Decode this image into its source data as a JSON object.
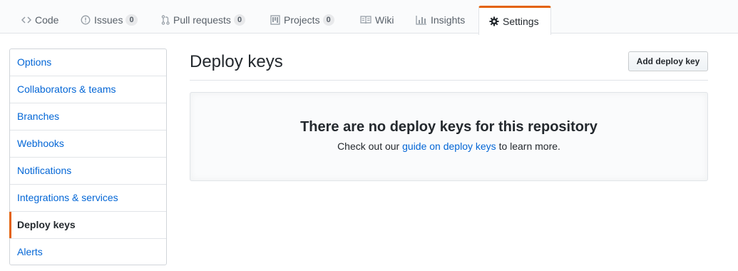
{
  "repo_nav": {
    "tabs": [
      {
        "label": "Code",
        "icon": "code-icon"
      },
      {
        "label": "Issues",
        "icon": "issue-icon",
        "count": "0"
      },
      {
        "label": "Pull requests",
        "icon": "pull-request-icon",
        "count": "0"
      },
      {
        "label": "Projects",
        "icon": "project-icon",
        "count": "0"
      },
      {
        "label": "Wiki",
        "icon": "book-icon"
      },
      {
        "label": "Insights",
        "icon": "graph-icon"
      },
      {
        "label": "Settings",
        "icon": "gear-icon",
        "selected": true
      }
    ],
    "accent_color": "#e36209"
  },
  "sidebar": {
    "items": [
      {
        "label": "Options"
      },
      {
        "label": "Collaborators & teams"
      },
      {
        "label": "Branches"
      },
      {
        "label": "Webhooks"
      },
      {
        "label": "Notifications"
      },
      {
        "label": "Integrations & services"
      },
      {
        "label": "Deploy keys",
        "selected": true
      },
      {
        "label": "Alerts"
      }
    ]
  },
  "main": {
    "title": "Deploy keys",
    "add_button": "Add deploy key",
    "blankslate": {
      "title": "There are no deploy keys for this repository",
      "text_before": "Check out our",
      "link": "guide on deploy keys",
      "text_after": "to learn more."
    }
  }
}
